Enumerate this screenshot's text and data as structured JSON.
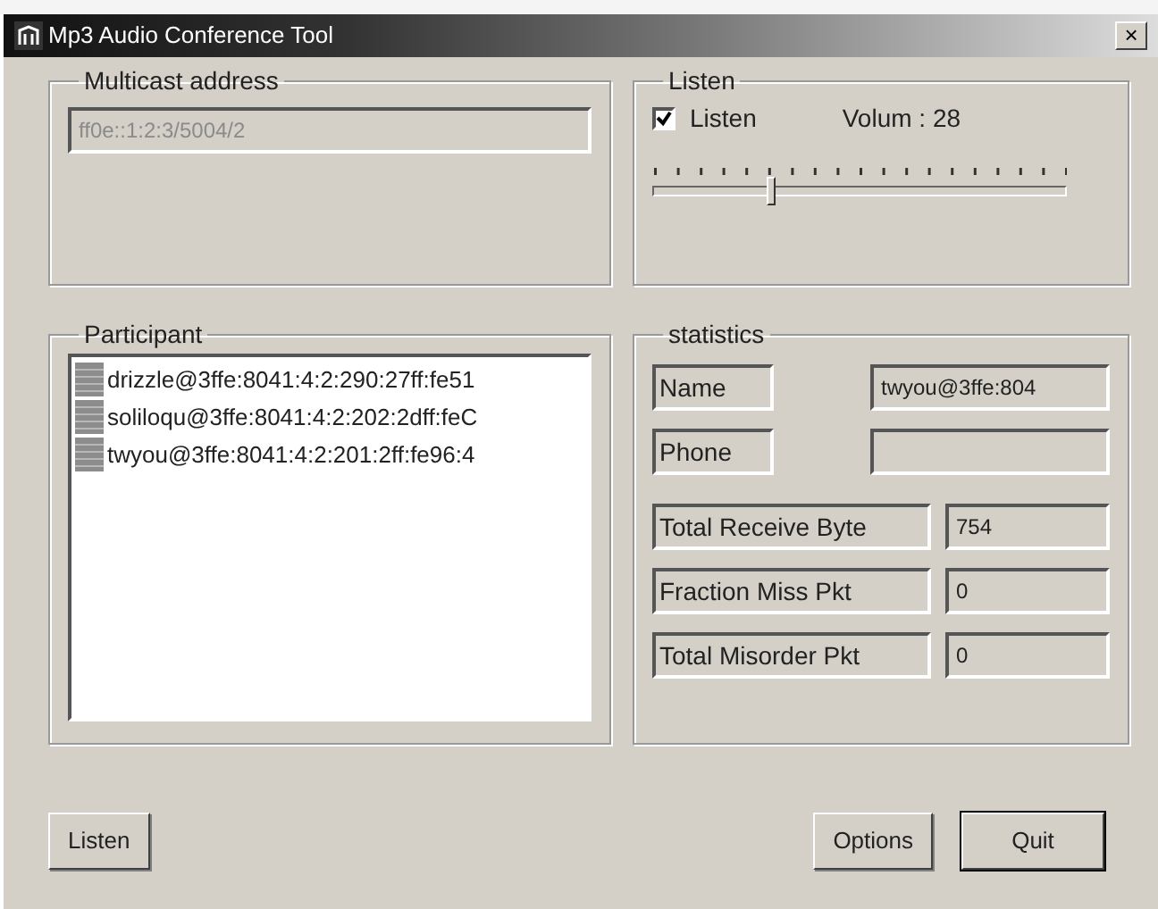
{
  "window": {
    "title": "Mp3 Audio Conference Tool",
    "close": "×"
  },
  "multicast": {
    "label": "Multicast address",
    "value": "ff0e::1:2:3/5004/2",
    "disabled": true
  },
  "listen": {
    "label": "Listen",
    "checkbox": {
      "label": "Listen",
      "checked": true
    },
    "volume_label": "Volum : 28",
    "slider": {
      "level": 0.28
    }
  },
  "participant": {
    "label": "Participant",
    "items": [
      {
        "name": "drizzle@3ffe:8041:4:2:290:27ff:fe51"
      },
      {
        "name": "soliloqu@3ffe:8041:4:2:202:2dff:feC"
      },
      {
        "name": "twyou@3ffe:8041:4:2:201:2ff:fe96:4"
      }
    ]
  },
  "statistics": {
    "label": "statistics",
    "identity": [
      {
        "label": "Name",
        "value": "twyou@3ffe:804"
      },
      {
        "label": "Phone"
      }
    ],
    "counters": [
      {
        "label": "Total Receive Byte",
        "value": "754"
      },
      {
        "label": "Fraction Miss Pkt",
        "value": "0"
      },
      {
        "label": "Total Misorder Pkt",
        "value": "0"
      }
    ]
  },
  "buttons_left": [
    {
      "label": "Listen",
      "default": false
    }
  ],
  "buttons_right": [
    {
      "label": "Options",
      "default": false
    },
    {
      "label": "Quit",
      "default": true
    }
  ]
}
